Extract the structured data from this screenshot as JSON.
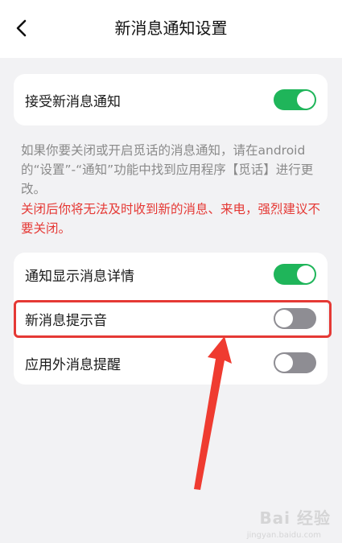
{
  "header": {
    "title": "新消息通知设置"
  },
  "card1": {
    "item": {
      "label": "接受新消息通知",
      "toggle": "on"
    }
  },
  "description": "如果你要关闭或开启觅话的消息通知，请在android的“设置”-“通知”功能中找到应用程序【觅话】进行更改。",
  "warning": "关闭后你将无法及时收到新的消息、来电，强烈建议不要关闭。",
  "card2": {
    "items": [
      {
        "label": "通知显示消息详情",
        "toggle": "on"
      },
      {
        "label": "新消息提示音",
        "toggle": "off"
      },
      {
        "label": "应用外消息提醒",
        "toggle": "off"
      }
    ]
  },
  "colors": {
    "toggle_on": "#1fb55a",
    "toggle_off": "#8e8d93",
    "annotation": "#e53935",
    "background": "#f2f2f4"
  },
  "icons": {
    "back": "chevron-left-icon"
  },
  "watermark": {
    "text": "Bai 经验",
    "sub": "jingyan.baidu.com"
  }
}
